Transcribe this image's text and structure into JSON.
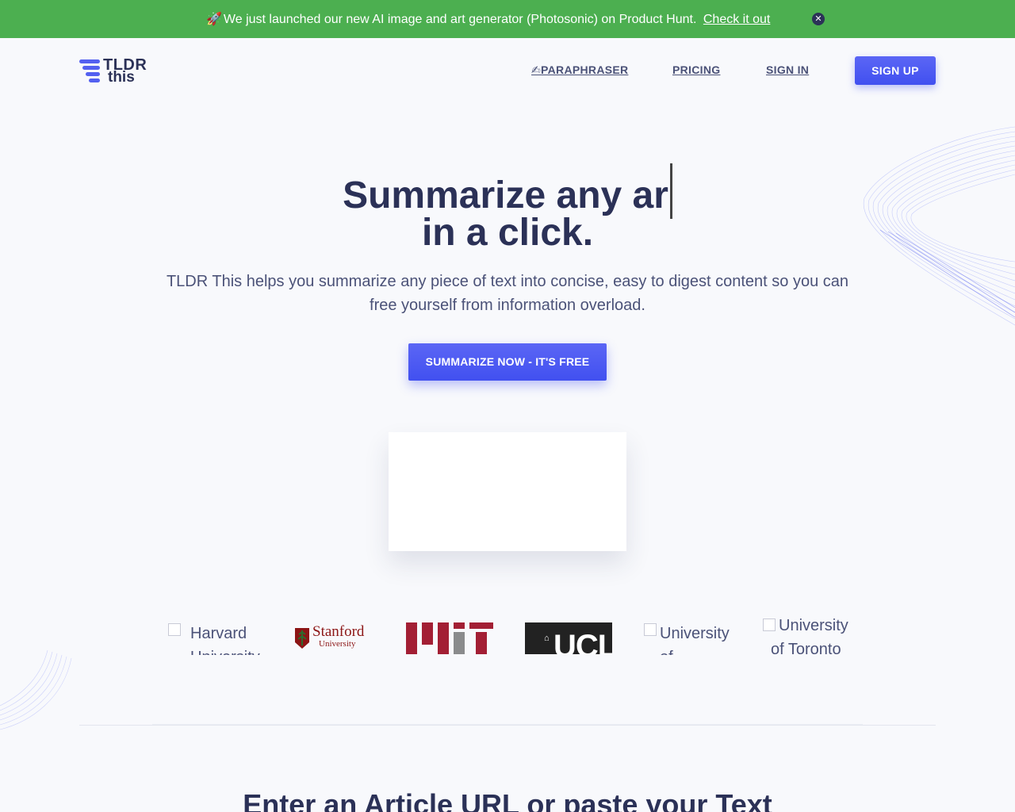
{
  "banner": {
    "rocket": "🚀",
    "text": "We just launched our new AI image and art generator (Photosonic) on Product Hunt.",
    "link_label": "Check it out",
    "close_symbol": "✕"
  },
  "header": {
    "logo_line1": "TLDR",
    "logo_line2": "this",
    "nav": {
      "paraphraser_icon": "✍",
      "paraphraser": "PARAPHRASER",
      "pricing": "PRICING",
      "signin": "SIGN IN",
      "signup": "SIGN UP"
    }
  },
  "hero": {
    "title_line1": "Summarize any ar",
    "title_line2": "in a click.",
    "subtitle": "TLDR This helps you summarize any piece of text into concise, easy to digest content so you can free yourself from information overload.",
    "cta": "SUMMARIZE NOW - IT'S FREE"
  },
  "universities": {
    "harvard_alt": "Harvard University",
    "stanford_name": "Stanford",
    "stanford_sub": "University",
    "ucl": "UCL",
    "uoft_alt": "University of ...",
    "toronto_alt": "University of Toronto"
  },
  "section": {
    "title": "Enter an Article URL or paste your Text"
  },
  "colors": {
    "banner_bg": "#4caf50",
    "brand_blue": "#4150f0",
    "heading": "#2b3157",
    "stanford_red": "#8c1515",
    "mit_red": "#a31f34"
  }
}
